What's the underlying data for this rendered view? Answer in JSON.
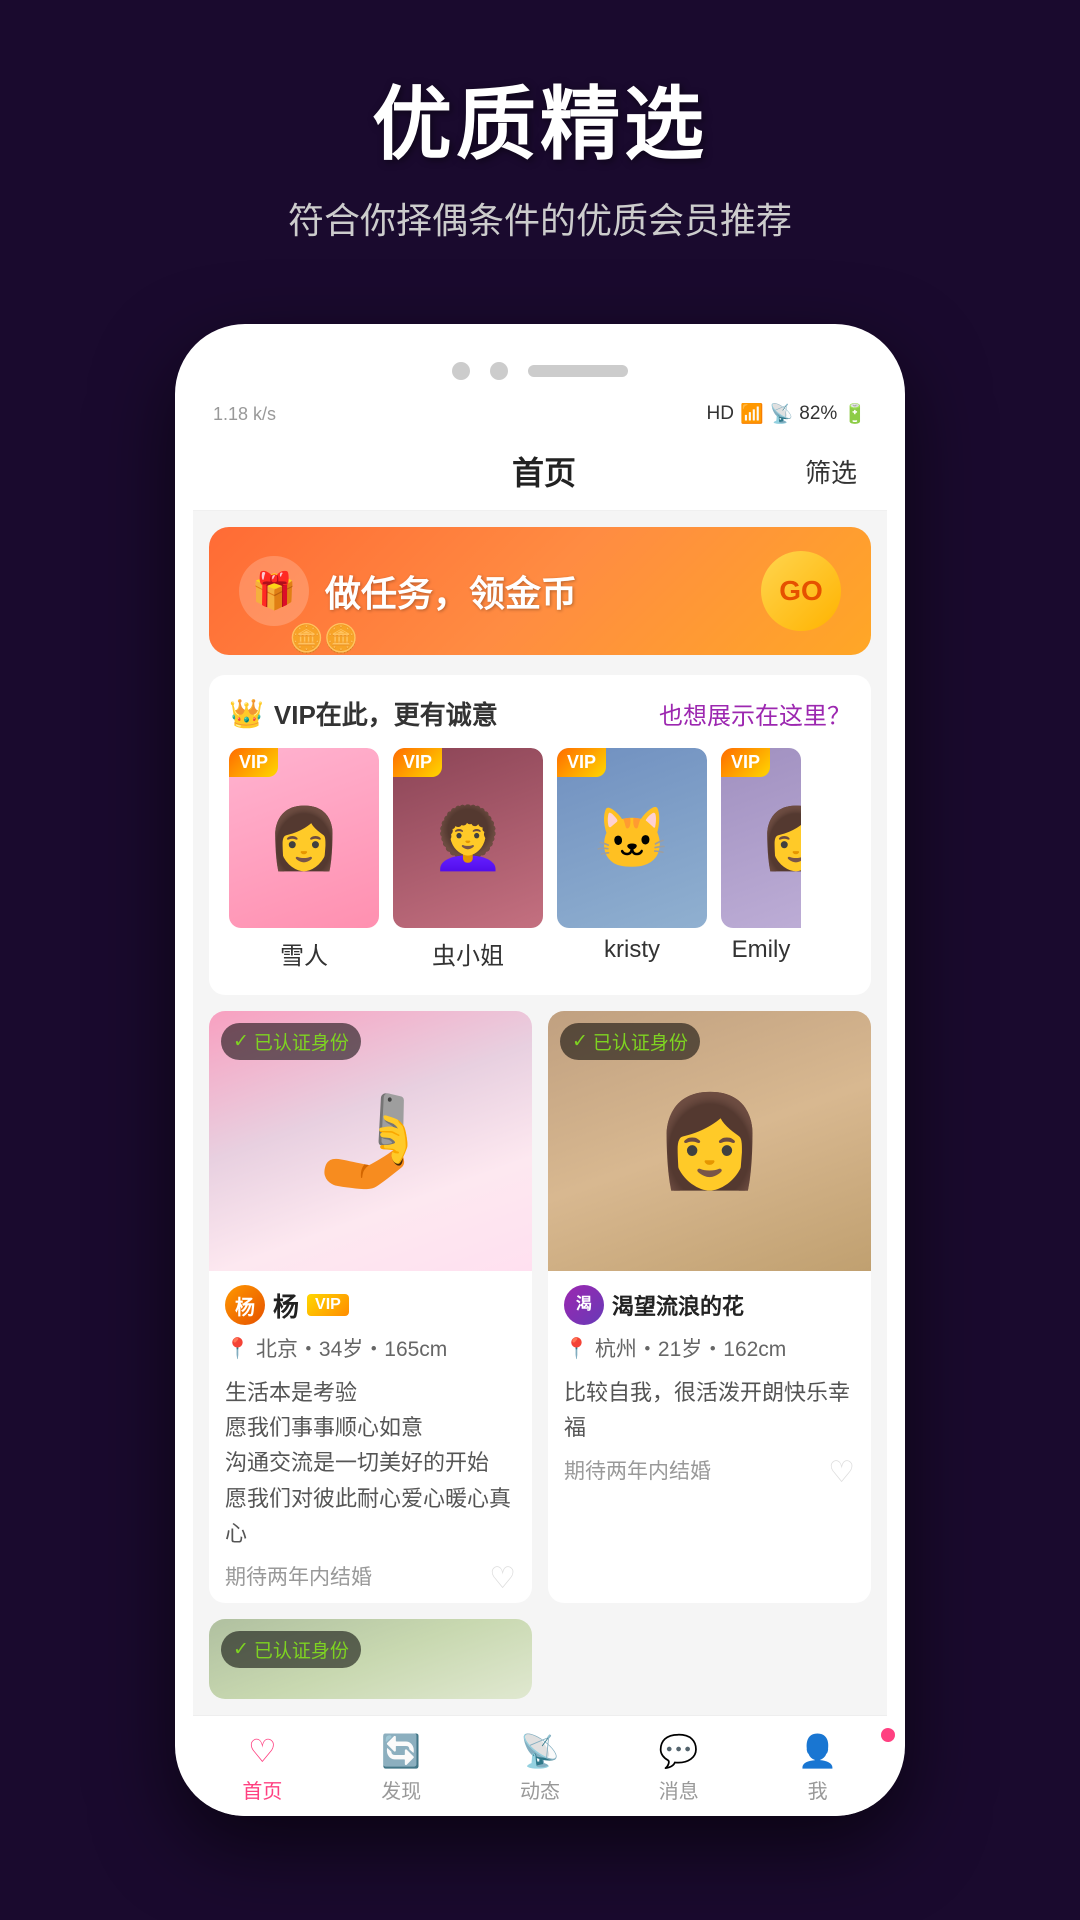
{
  "promo": {
    "title": "优质精选",
    "subtitle": "符合你择偶条件的优质会员推荐"
  },
  "status_bar": {
    "network_speed": "1.18 k/s",
    "hd": "HD",
    "battery": "82%",
    "time": ""
  },
  "header": {
    "title": "首页",
    "filter": "筛选"
  },
  "banner": {
    "text": "做任务，领金币",
    "go_label": "GO"
  },
  "vip_section": {
    "title": "VIP在此，更有诚意",
    "link": "也想展示在这里？",
    "members": [
      {
        "name": "雪人",
        "badge": "VIP"
      },
      {
        "name": "虫小姐",
        "badge": "VIP"
      },
      {
        "name": "kristy",
        "badge": "VIP"
      },
      {
        "name": "Emily",
        "badge": "VIP"
      }
    ]
  },
  "persons": [
    {
      "name": "杨",
      "vip": true,
      "verified": "已认证身份",
      "location": "北京・34岁・165cm",
      "bio": "生活本是考验\n愿我们事事顺心如意\n沟通交流是一切美好的开始\n愿我们对彼此耐心爱心暖心真心",
      "expect": "期待两年内结婚"
    },
    {
      "name": "渴望流浪的花",
      "vip": false,
      "verified": "已认证身份",
      "location": "杭州・21岁・162cm",
      "bio": "比较自我，很活泼开朗快乐幸福",
      "expect": "期待两年内结婚"
    }
  ],
  "bottom_nav": {
    "items": [
      {
        "label": "首页",
        "icon": "heart",
        "active": true
      },
      {
        "label": "发现",
        "icon": "discover",
        "active": false
      },
      {
        "label": "动态",
        "icon": "broadcast",
        "active": false
      },
      {
        "label": "消息",
        "icon": "message",
        "active": false
      },
      {
        "label": "我",
        "icon": "profile",
        "active": false,
        "badge": true
      }
    ]
  }
}
